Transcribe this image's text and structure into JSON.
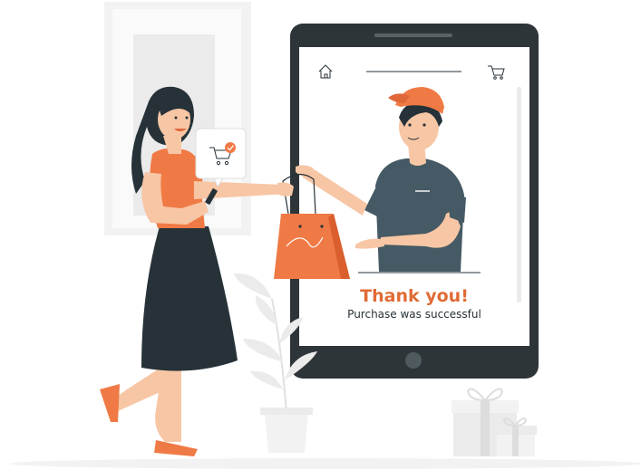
{
  "screen": {
    "thank_title": "Thank you!",
    "thank_subtitle": "Purchase was successful"
  },
  "icons": {
    "nav_home": "home-icon",
    "nav_cart": "cart-icon",
    "bubble_cart": "cart-check-icon",
    "home_button": "home-button-icon"
  },
  "colors": {
    "accent": "#F07A45",
    "accent_text": "#E06B35",
    "dark": "#263238",
    "tablet": "#2E3538",
    "shirt": "#455A64"
  }
}
